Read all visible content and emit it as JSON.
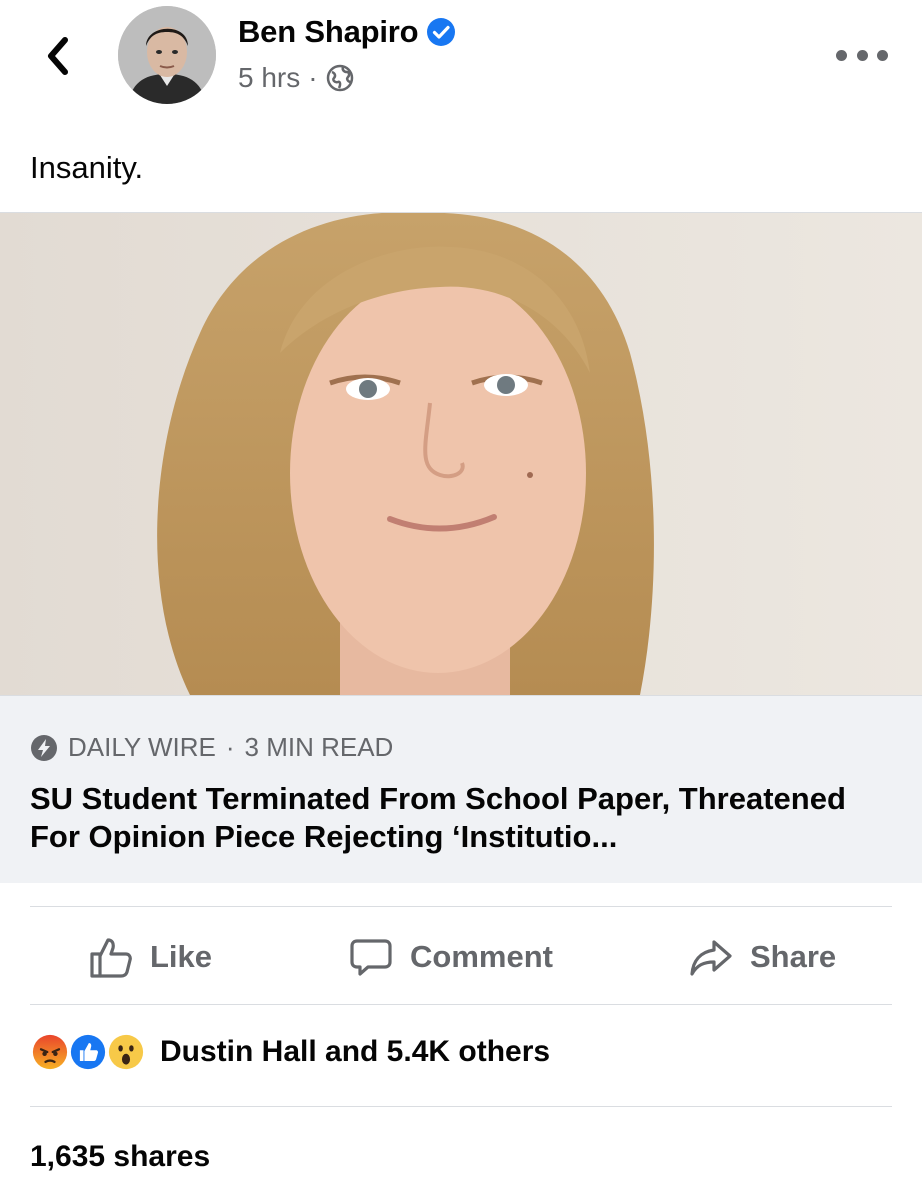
{
  "post": {
    "author": "Ben Shapiro",
    "timestamp": "5 hrs",
    "separator": "·",
    "privacy_icon": "globe-icon",
    "text": "Insanity."
  },
  "link": {
    "source": "DAILY WIRE",
    "read_time": "3 MIN READ",
    "title": "SU Student Terminated From School Paper, Threatened For Opinion Piece Rejecting ‘Institutio..."
  },
  "actions": {
    "like": "Like",
    "comment": "Comment",
    "share": "Share"
  },
  "engagement": {
    "reactions": [
      "angry",
      "like",
      "wow"
    ],
    "reaction_summary": "Dustin Hall and 5.4K others",
    "shares": "1,635 shares"
  },
  "colors": {
    "verified": "#1877f2",
    "secondary_text": "#65676b",
    "link_footer_bg": "#f0f2f5"
  }
}
